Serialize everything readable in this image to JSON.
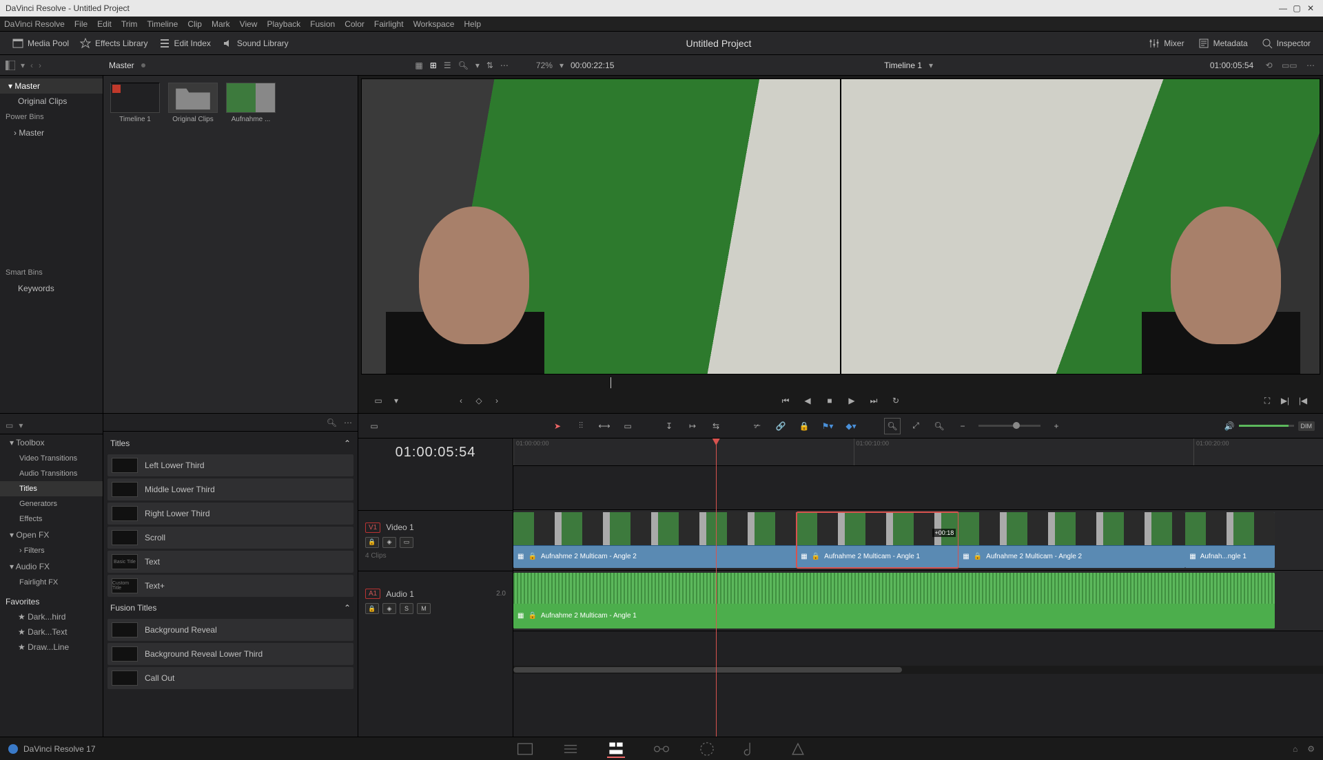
{
  "titlebar": {
    "text": "DaVinci Resolve - Untitled Project"
  },
  "menu": [
    "DaVinci Resolve",
    "File",
    "Edit",
    "Trim",
    "Timeline",
    "Clip",
    "Mark",
    "View",
    "Playback",
    "Fusion",
    "Color",
    "Fairlight",
    "Workspace",
    "Help"
  ],
  "toolbar": {
    "media_pool": "Media Pool",
    "effects_library": "Effects Library",
    "edit_index": "Edit Index",
    "sound_library": "Sound Library",
    "project_title": "Untitled Project",
    "mixer": "Mixer",
    "metadata": "Metadata",
    "inspector": "Inspector"
  },
  "secondrow": {
    "breadcrumb": "Master",
    "zoom": "72%",
    "src_tc": "00:00:22:15",
    "timeline_name": "Timeline 1",
    "rec_tc": "01:00:05:54"
  },
  "bins_tree": {
    "master": "Master",
    "original_clips": "Original Clips",
    "power_bins": "Power Bins",
    "pb_master": "Master",
    "smart_bins": "Smart Bins",
    "keywords": "Keywords"
  },
  "bin_items": [
    {
      "label": "Timeline 1",
      "kind": "timeline"
    },
    {
      "label": "Original Clips",
      "kind": "folder"
    },
    {
      "label": "Aufnahme ...",
      "kind": "clip"
    }
  ],
  "fx_tree": {
    "toolbox": "Toolbox",
    "video_trans": "Video Transitions",
    "audio_trans": "Audio Transitions",
    "titles": "Titles",
    "generators": "Generators",
    "effects": "Effects",
    "openfx": "Open FX",
    "filters": "Filters",
    "audiofx": "Audio FX",
    "fairlightfx": "Fairlight FX"
  },
  "fx_titles_hdr": "Titles",
  "fx_titles": [
    "Left Lower Third",
    "Middle Lower Third",
    "Right Lower Third",
    "Scroll",
    "Text",
    "Text+"
  ],
  "fx_fusion_hdr": "Fusion Titles",
  "fx_fusion": [
    "Background Reveal",
    "Background Reveal Lower Third",
    "Call Out"
  ],
  "favorites": {
    "hdr": "Favorites",
    "items": [
      "Dark...hird",
      "Dark...Text",
      "Draw...Line"
    ]
  },
  "timeline": {
    "tc": "01:00:05:54",
    "ruler": [
      "01:00:00:00",
      "01:00:10:00",
      "01:00:20:00"
    ],
    "video_track": "Video 1",
    "video_tag": "V1",
    "video_sub": "4 Clips",
    "audio_track": "Audio 1",
    "audio_tag": "A1",
    "audio_ch": "2.0",
    "clips": {
      "v1": "Aufnahme 2 Multicam - Angle 2",
      "v2": "Aufnahme 2 Multicam - Angle 1",
      "v2_dur": "+00:18",
      "v3": "Aufnahme 2 Multicam - Angle 2",
      "v4": "Aufnah...ngle 1",
      "a1": "Aufnahme 2 Multicam - Angle 1"
    },
    "btn_s": "S",
    "btn_m": "M"
  },
  "pagenav": {
    "app": "DaVinci Resolve 17"
  },
  "dim_label": "DIM"
}
